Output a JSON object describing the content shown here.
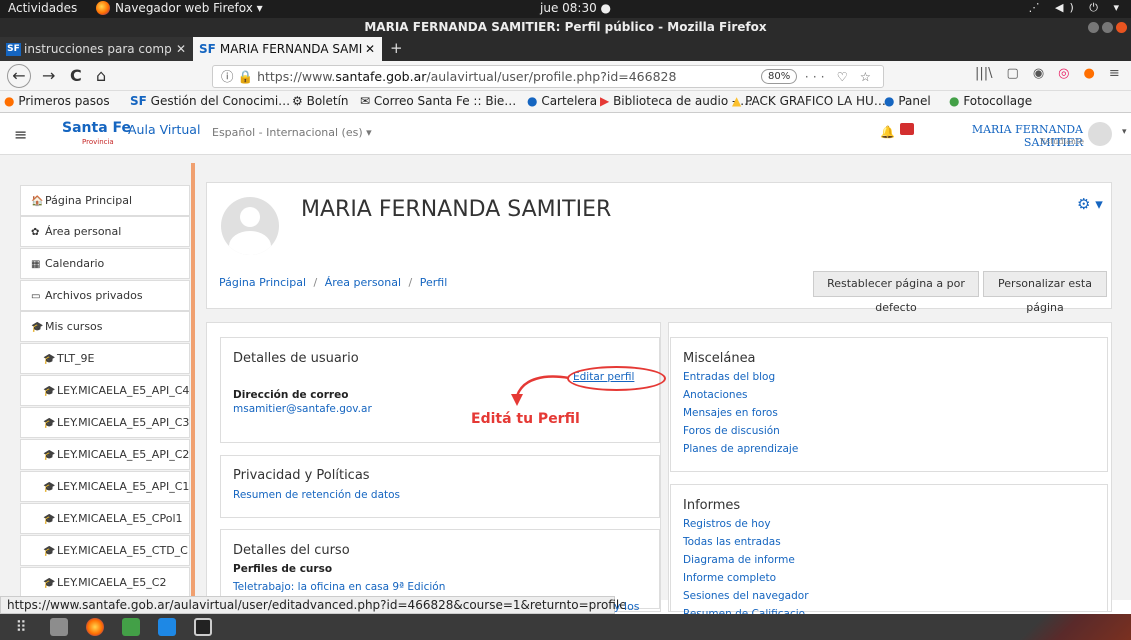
{
  "os_bar": {
    "activities": "Actividades",
    "app": "Navegador web Firefox ▾",
    "clock": "jue 08:30 ●",
    "tray": "⋰ ◀) ⏻ ▾"
  },
  "window": {
    "title": "MARIA FERNANDA SAMITIER: Perfil público - Mozilla Firefox"
  },
  "tabs": [
    {
      "label": "instrucciones para comp",
      "icon": "SF"
    },
    {
      "label": "MARIA FERNANDA SAMI",
      "icon": "SF"
    }
  ],
  "tab_close": "✕",
  "new_tab": "+",
  "nav": {
    "back": "←",
    "forward": "→",
    "reload": "C",
    "home": "⌂"
  },
  "url": {
    "prefix": "https://www.",
    "domain": "santafe.gob.ar",
    "path": "/aulavirtual/user/profile.php?id=466828",
    "zoom": "80%",
    "actions": "··· ♡ ☆"
  },
  "toolbar_icons": [
    "|||\\",
    "▢",
    "◉",
    "◎",
    "●",
    "≡"
  ],
  "bookmarks": [
    {
      "label": "Primeros pasos",
      "icon": "firefox-icon"
    },
    {
      "label": "Gestión del Conocimi…",
      "icon": "sf-icon"
    },
    {
      "label": "Boletín",
      "icon": "gear-icon"
    },
    {
      "label": "Correo Santa Fe :: Bie…",
      "icon": "mail-icon"
    },
    {
      "label": "Cartelera",
      "icon": "chat-icon"
    },
    {
      "label": "Biblioteca de audio - …",
      "icon": "youtube-icon"
    },
    {
      "label": "PACK GRAFICO LA HU…",
      "icon": "drive-icon"
    },
    {
      "label": "Panel",
      "icon": "chat-icon"
    },
    {
      "label": "Fotocollage",
      "icon": "photo-icon"
    }
  ],
  "bm_sf": "SF",
  "moodle_nav": {
    "menu": "≡",
    "logo": "Santa Fe",
    "logo_sub": "Provincia",
    "site": "Aula Virtual",
    "lang": "Español - Internacional (es) ▾",
    "bell": "🔔",
    "user": "MARIA FERNANDA SAMITIER",
    "role": "Estudiante",
    "caret": "▾"
  },
  "drawer": [
    {
      "label": "Página Principal",
      "icon": "🏠"
    },
    {
      "label": "Área personal",
      "icon": "✿"
    },
    {
      "label": "Calendario",
      "icon": "▦"
    },
    {
      "label": "Archivos privados",
      "icon": "▭"
    },
    {
      "label": "Mis cursos",
      "icon": "🎓"
    },
    {
      "label": "TLT_9E",
      "icon": "🎓"
    },
    {
      "label": "LEY.MICAELA_E5_API_C4",
      "icon": "🎓"
    },
    {
      "label": "LEY.MICAELA_E5_API_C3",
      "icon": "🎓"
    },
    {
      "label": "LEY.MICAELA_E5_API_C2",
      "icon": "🎓"
    },
    {
      "label": "LEY.MICAELA_E5_API_C1",
      "icon": "🎓"
    },
    {
      "label": "LEY.MICAELA_E5_CPol1",
      "icon": "🎓"
    },
    {
      "label": "LEY.MICAELA_E5_CTD_C1",
      "icon": "🎓"
    },
    {
      "label": "LEY.MICAELA_E5_C2",
      "icon": "🎓"
    }
  ],
  "profile": {
    "name": "MARIA FERNANDA SAMITIER",
    "gear": "⚙ ▾",
    "breadcrumb": [
      "Página Principal",
      "Área personal",
      "Perfil"
    ],
    "sep": "/",
    "reset": "Restablecer página a por defecto",
    "customize": "Personalizar esta página"
  },
  "user_details": {
    "title": "Detalles de usuario",
    "edit": "Editar perfil",
    "email_label": "Dirección de correo",
    "email": "msamitier@santafe.gov.ar"
  },
  "privacy": {
    "title": "Privacidad y Políticas",
    "link": "Resumen de retención de datos"
  },
  "course": {
    "title": "Detalles del curso",
    "profiles_label": "Perfiles de curso",
    "link": "Teletrabajo: la oficina en casa 9ª Edición"
  },
  "misc": {
    "title": "Miscelánea",
    "links": [
      "Entradas del blog",
      "Anotaciones",
      "Mensajes en foros",
      "Foros de discusión",
      "Planes de aprendizaje"
    ]
  },
  "reports": {
    "title": "Informes",
    "links": [
      "Registros de hoy",
      "Todas las entradas",
      "Diagrama de informe",
      "Informe completo",
      "Sesiones del navegador",
      "Resumen de Calificacio..."
    ]
  },
  "annotation": {
    "text": "Editá tu Perfil",
    "color": "#e53935"
  },
  "status": {
    "url": "https://www.santafe.gob.ar/aulavirtual/user/editadvanced.php?id=466828&course=1&returnto=profile",
    "rest": "y los"
  },
  "dock": [
    "apps-grid-icon",
    "files-icon",
    "firefox-icon",
    "calc-icon",
    "writer-icon",
    "screen-icon"
  ]
}
